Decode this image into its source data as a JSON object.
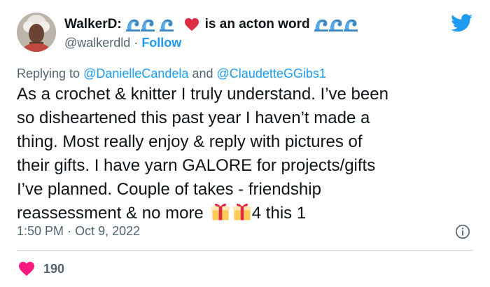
{
  "author": {
    "name": "WalkerD:",
    "name_suffix": "is an acton word",
    "handle": "@walkerdld",
    "separator": "·",
    "follow_label": "Follow"
  },
  "reply": {
    "prefix": "Replying to",
    "user1": "@DanielleCandela",
    "conjunction": "and",
    "user2": "@ClaudetteGGibs1"
  },
  "tweet": {
    "lines": [
      "As a crochet & knitter I truly understand. I’ve been",
      "so disheartened this past year I haven’t made a",
      "thing. Most really enjoy & reply with pictures of",
      "their gifts. I have yarn GALORE for projects/gifts",
      "I’ve planned. Couple of takes - friendship"
    ],
    "last_line_text": "reassessment & no more",
    "last_line_end": "4 this 1"
  },
  "meta": {
    "time": "1:50 PM",
    "separator": "·",
    "date": "Oct 9, 2022"
  },
  "likes": {
    "count": "190"
  },
  "colors": {
    "accent": "#1d9bf0",
    "like": "#f91880",
    "muted": "#536471",
    "text": "#0f1419"
  },
  "icons": [
    "wave-emoji",
    "red-heart-emoji",
    "twitter-bird-icon",
    "gift-emoji",
    "info-icon",
    "heart-icon"
  ]
}
